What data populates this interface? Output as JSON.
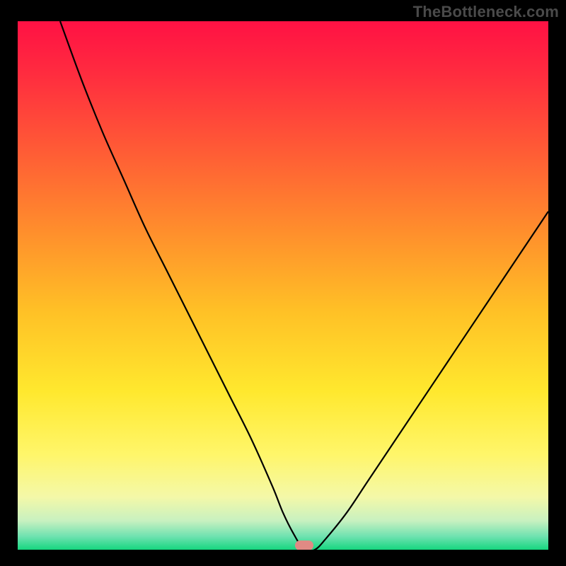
{
  "watermark": "TheBottleneck.com",
  "chart_data": {
    "type": "line",
    "title": "",
    "xlabel": "",
    "ylabel": "",
    "xlim": [
      0,
      100
    ],
    "ylim": [
      0,
      100
    ],
    "marker": {
      "x": 54,
      "color": "#e08a84"
    },
    "series": [
      {
        "name": "bottleneck-curve",
        "x": [
          8,
          12,
          16,
          20,
          24,
          28,
          32,
          36,
          40,
          44,
          48,
          50,
          52,
          54,
          56,
          58,
          62,
          66,
          72,
          78,
          84,
          90,
          96,
          100
        ],
        "values": [
          100,
          89,
          79,
          70,
          61,
          53,
          45,
          37,
          29,
          21,
          12,
          7,
          3,
          0,
          0,
          2,
          7,
          13,
          22,
          31,
          40,
          49,
          58,
          64
        ]
      }
    ],
    "colors": {
      "curve": "#000000",
      "marker": "#e08a84",
      "gradient_stops": [
        {
          "offset": 0.0,
          "color": "#ff1144"
        },
        {
          "offset": 0.1,
          "color": "#ff2c3f"
        },
        {
          "offset": 0.25,
          "color": "#ff5d35"
        },
        {
          "offset": 0.4,
          "color": "#ff8f2c"
        },
        {
          "offset": 0.55,
          "color": "#ffc126"
        },
        {
          "offset": 0.7,
          "color": "#ffe82e"
        },
        {
          "offset": 0.82,
          "color": "#fff66a"
        },
        {
          "offset": 0.9,
          "color": "#f4f8a8"
        },
        {
          "offset": 0.945,
          "color": "#c8f1c0"
        },
        {
          "offset": 0.975,
          "color": "#6ee2b0"
        },
        {
          "offset": 1.0,
          "color": "#16d67f"
        }
      ]
    }
  }
}
